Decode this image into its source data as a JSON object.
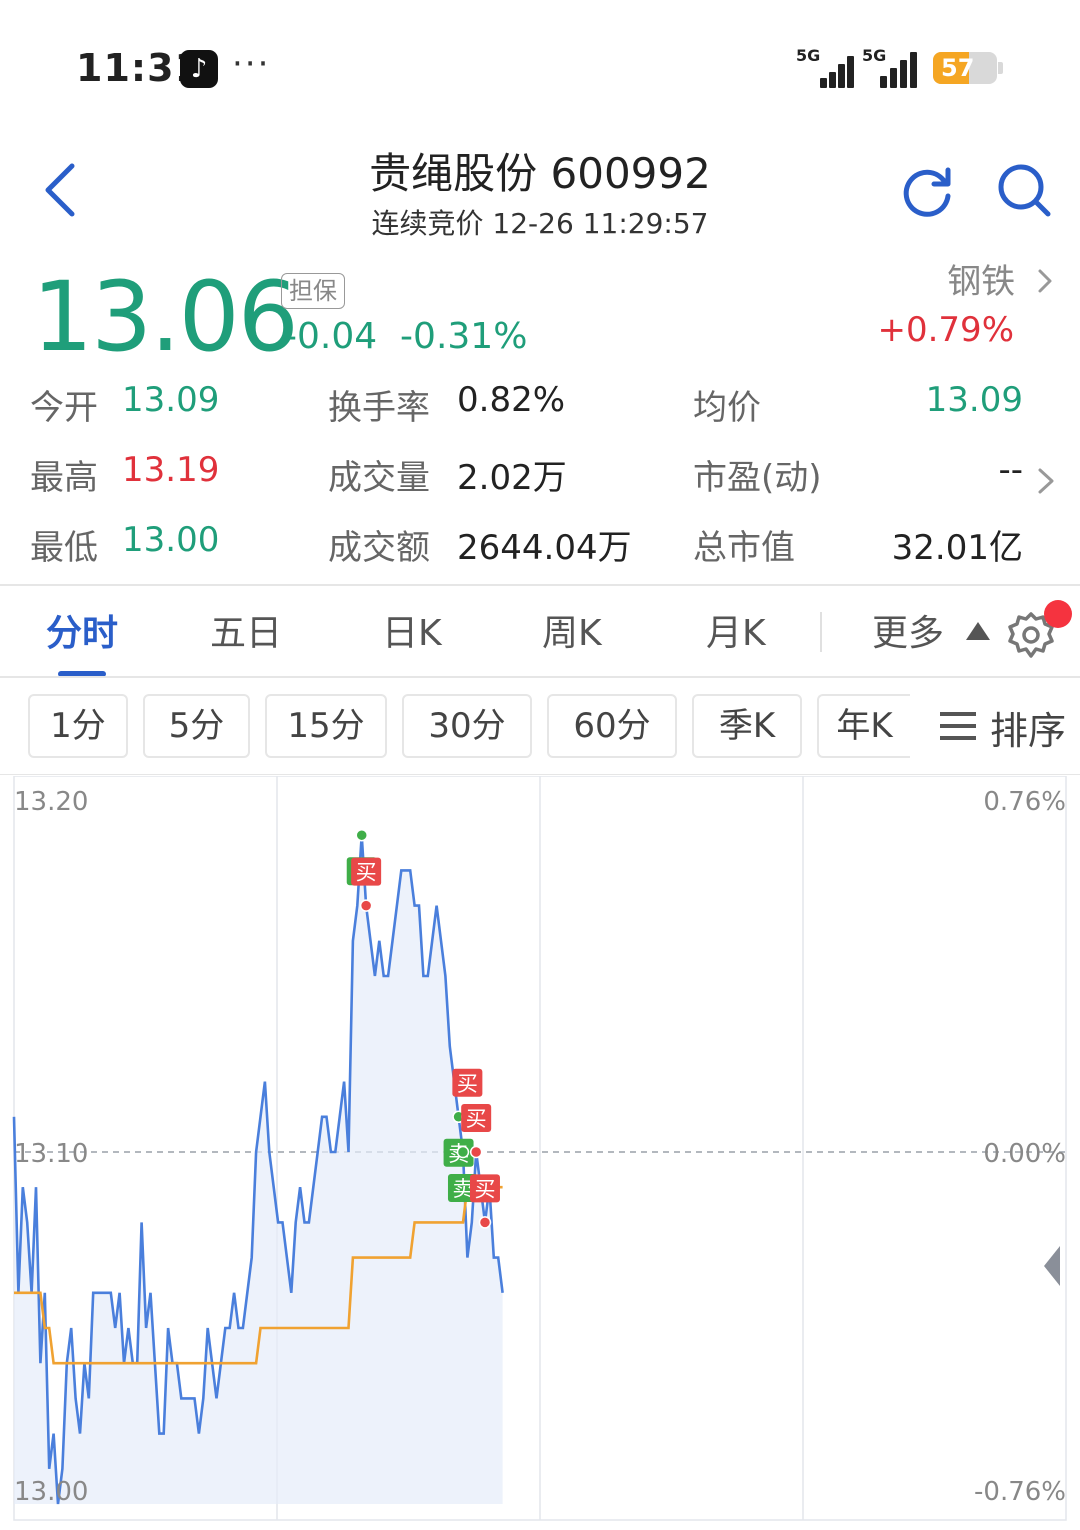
{
  "status_bar": {
    "time": "11:31",
    "app_icon": "tiktok-icon",
    "more": "···",
    "sim1": "5G",
    "sim2": "5G",
    "battery": "57",
    "battery_level": 0.57
  },
  "header": {
    "title": "贵绳股份 600992",
    "subtitle": "连续竞价 12-26 11:29:57"
  },
  "quote": {
    "price": "13.06",
    "badge": "担保",
    "change": "-0.04",
    "change_pct": "-0.31%",
    "sector": "钢铁",
    "sector_change": "+0.79%",
    "colors": {
      "down": "#1f9e7a",
      "up": "#e0313b",
      "accent": "#2a5ec9"
    }
  },
  "stats": [
    {
      "label": "今开",
      "value": "13.09",
      "tone": "green"
    },
    {
      "label": "换手率",
      "value": "0.82%",
      "tone": ""
    },
    {
      "label": "均价",
      "value": "13.09",
      "tone": "green"
    },
    {
      "label": "最高",
      "value": "13.19",
      "tone": "red"
    },
    {
      "label": "成交量",
      "value": "2.02万",
      "tone": ""
    },
    {
      "label": "市盈(动)",
      "value": "--",
      "tone": ""
    },
    {
      "label": "最低",
      "value": "13.00",
      "tone": "green"
    },
    {
      "label": "成交额",
      "value": "2644.04万",
      "tone": ""
    },
    {
      "label": "总市值",
      "value": "32.01亿",
      "tone": ""
    }
  ],
  "tabs": [
    {
      "label": "分时",
      "active": true
    },
    {
      "label": "五日",
      "active": false
    },
    {
      "label": "日K",
      "active": false
    },
    {
      "label": "周K",
      "active": false
    },
    {
      "label": "月K",
      "active": false
    },
    {
      "label": "更多",
      "active": false
    }
  ],
  "intervals": [
    "1分",
    "5分",
    "15分",
    "30分",
    "60分",
    "季K",
    "年K"
  ],
  "sort_label": "排序",
  "chart_data": {
    "type": "line",
    "y_left_ticks": [
      "13.20",
      "13.10",
      "13.00"
    ],
    "y_right_ticks": [
      "0.76%",
      "0.00%",
      "-0.76%"
    ],
    "ylim": [
      13.0,
      13.2
    ],
    "prev_close": 13.1,
    "series": [
      {
        "values": [
          13.11,
          13.06,
          13.09,
          13.08,
          13.06,
          13.09,
          13.04,
          13.06,
          13.01,
          13.02,
          13.0,
          13.01,
          13.04,
          13.05,
          13.03,
          13.02,
          13.04,
          13.03,
          13.06,
          13.06,
          13.06,
          13.06,
          13.06,
          13.05,
          13.06,
          13.04,
          13.05,
          13.04,
          13.04,
          13.08,
          13.05,
          13.06,
          13.04,
          13.02,
          13.02,
          13.05,
          13.04,
          13.04,
          13.03,
          13.03,
          13.03,
          13.03,
          13.02,
          13.03,
          13.05,
          13.04,
          13.03,
          13.04,
          13.05,
          13.05,
          13.06,
          13.05,
          13.05,
          13.06,
          13.07,
          13.1,
          13.11,
          13.12,
          13.1,
          13.09,
          13.08,
          13.08,
          13.07,
          13.06,
          13.08,
          13.09,
          13.08,
          13.08,
          13.09,
          13.1,
          13.11,
          13.11,
          13.1,
          13.1,
          13.11,
          13.12,
          13.1,
          13.16,
          13.17,
          13.19,
          13.17,
          13.16,
          13.15,
          13.16,
          13.15,
          13.15,
          13.16,
          13.17,
          13.18,
          13.18,
          13.18,
          13.17,
          13.17,
          13.15,
          13.15,
          13.16,
          13.17,
          13.16,
          13.15,
          13.13,
          13.12,
          13.11,
          13.1,
          13.07,
          13.08,
          13.1,
          13.09,
          13.08,
          13.09,
          13.07,
          13.07,
          13.06
        ]
      },
      {
        "values": [
          13.06,
          13.06,
          13.06,
          13.06,
          13.06,
          13.06,
          13.06,
          13.05,
          13.05,
          13.04,
          13.04,
          13.04,
          13.04,
          13.04,
          13.04,
          13.04,
          13.04,
          13.04,
          13.04,
          13.04,
          13.04,
          13.04,
          13.04,
          13.04,
          13.04,
          13.04,
          13.04,
          13.04,
          13.04,
          13.04,
          13.04,
          13.04,
          13.04,
          13.04,
          13.04,
          13.04,
          13.04,
          13.04,
          13.04,
          13.04,
          13.04,
          13.04,
          13.04,
          13.04,
          13.04,
          13.04,
          13.04,
          13.04,
          13.04,
          13.04,
          13.04,
          13.04,
          13.04,
          13.04,
          13.04,
          13.04,
          13.05,
          13.05,
          13.05,
          13.05,
          13.05,
          13.05,
          13.05,
          13.05,
          13.05,
          13.05,
          13.05,
          13.05,
          13.05,
          13.05,
          13.05,
          13.05,
          13.05,
          13.05,
          13.05,
          13.05,
          13.05,
          13.07,
          13.07,
          13.07,
          13.07,
          13.07,
          13.07,
          13.07,
          13.07,
          13.07,
          13.07,
          13.07,
          13.07,
          13.07,
          13.07,
          13.08,
          13.08,
          13.08,
          13.08,
          13.08,
          13.08,
          13.08,
          13.08,
          13.08,
          13.08,
          13.08,
          13.08,
          13.09,
          13.09,
          13.09,
          13.09,
          13.09,
          13.09,
          13.09,
          13.09,
          13.09
        ]
      }
    ],
    "trade_markers": [
      {
        "label": "卖",
        "index": 79,
        "value": 13.19,
        "side": "sell"
      },
      {
        "label": "买",
        "index": 80,
        "value": 13.17,
        "side": "buy"
      },
      {
        "label": "卖",
        "index": 101,
        "value": 13.11,
        "side": "sell"
      },
      {
        "label": "买",
        "index": 103,
        "value": 13.11,
        "side": "buy"
      },
      {
        "label": "卖",
        "index": 102,
        "value": 13.1,
        "side": "sell"
      },
      {
        "label": "买",
        "index": 105,
        "value": 13.1,
        "side": "buy"
      },
      {
        "label": "买",
        "index": 107,
        "value": 13.08,
        "side": "buy"
      }
    ]
  }
}
